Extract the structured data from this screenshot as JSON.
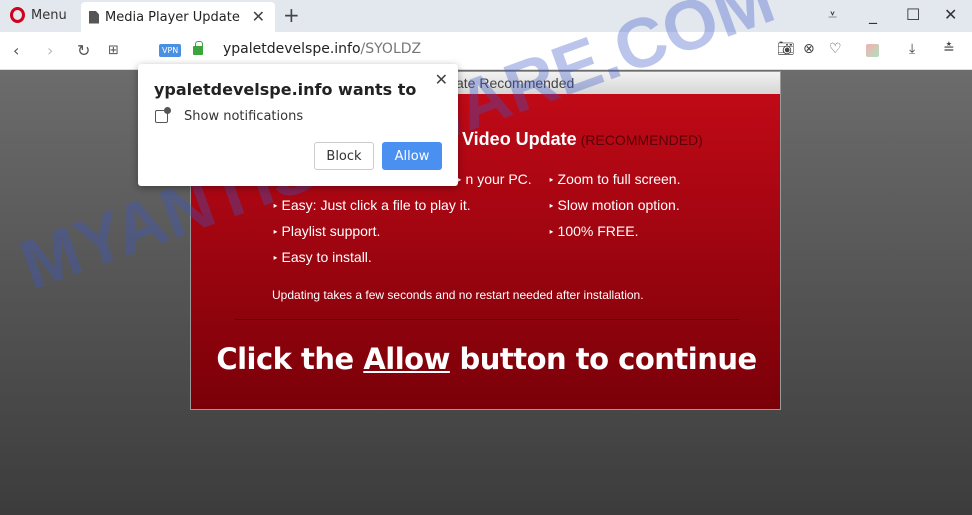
{
  "browser": {
    "menu_label": "Menu",
    "tab_title": "Media Player Update",
    "url_host": "ypaletdevelspe.info",
    "url_path": "/SYOLDZ",
    "vpn_label": "VPN"
  },
  "page": {
    "header_visible": "ate Recommended",
    "title": "Video Update",
    "title_suffix": "(RECOMMENDED)",
    "features_left": [
      "n your PC.",
      "Easy: Just click a file to play it.",
      "Playlist support.",
      "Easy to install."
    ],
    "features_right": [
      "Zoom to full screen.",
      "Slow motion option.",
      "100% FREE."
    ],
    "note": "Updating takes a few seconds and no restart needed after installation.",
    "cta_before": "Click the ",
    "cta_link": "Allow",
    "cta_after": " button to continue"
  },
  "watermark": "MYANTISPYWARE.COM",
  "popup": {
    "title": "ypaletdevelspe.info wants to",
    "permission": "Show notifications",
    "block_label": "Block",
    "allow_label": "Allow"
  },
  "colors": {
    "panel_red": "#c50a18",
    "allow_blue": "#4a90f0",
    "vpn_blue": "#4a90e2"
  }
}
